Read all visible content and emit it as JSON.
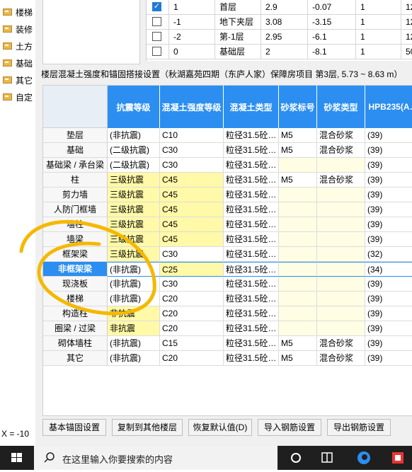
{
  "sidebar": {
    "items": [
      "楼梯",
      "装修",
      "土方",
      "基础",
      "其它",
      "自定"
    ]
  },
  "status": {
    "coordinate": "X = -10"
  },
  "floor_table": {
    "rows": [
      {
        "checked": true,
        "code": "1",
        "name": "首层",
        "height": "2.9",
        "elevation": "-0.07",
        "count": "1",
        "extra": "12"
      },
      {
        "checked": false,
        "code": "-1",
        "name": "地下夹层",
        "height": "3.08",
        "elevation": "-3.15",
        "count": "1",
        "extra": "12"
      },
      {
        "checked": false,
        "code": "-2",
        "name": "第-1层",
        "height": "2.95",
        "elevation": "-6.1",
        "count": "1",
        "extra": "12"
      },
      {
        "checked": false,
        "code": "0",
        "name": "基础层",
        "height": "2",
        "elevation": "-8.1",
        "count": "1",
        "extra": "50"
      }
    ]
  },
  "caption": "楼层混凝土强度和锚固搭接设置（秋湖嘉苑四期（东庐人家）保障房项目 第3层, 5.73 ~ 8.63 m）",
  "grid": {
    "headers": [
      "抗震等级",
      "混凝土强度等级",
      "混凝土类型",
      "砂浆标号",
      "砂浆类型",
      "HPB235(A…"
    ],
    "rows": [
      {
        "name": "垫层",
        "seismic": "(非抗震)",
        "grade": "C10",
        "type": "粒径31.5砼…",
        "mortar": "M5",
        "mtype": "混合砂浆",
        "hpb": "(39)",
        "y": [
          false,
          false,
          false,
          false,
          false
        ]
      },
      {
        "name": "基础",
        "seismic": "(二级抗震)",
        "grade": "C30",
        "type": "粒径31.5砼…",
        "mortar": "M5",
        "mtype": "混合砂浆",
        "hpb": "(39)",
        "y": [
          false,
          false,
          false,
          false,
          false
        ]
      },
      {
        "name": "基础梁 / 承台梁",
        "seismic": "(二级抗震)",
        "grade": "C30",
        "type": "粒径31.5砼…",
        "mortar": "",
        "mtype": "",
        "hpb": "(39)",
        "y": [
          false,
          false,
          false,
          true,
          true
        ]
      },
      {
        "name": "柱",
        "seismic": "三级抗震",
        "grade": "C45",
        "type": "粒径31.5砼…",
        "mortar": "M5",
        "mtype": "混合砂浆",
        "hpb": "(39)",
        "y": [
          true,
          true,
          false,
          false,
          false
        ]
      },
      {
        "name": "剪力墙",
        "seismic": "三级抗震",
        "grade": "C45",
        "type": "粒径31.5砼…",
        "mortar": "",
        "mtype": "",
        "hpb": "(39)",
        "y": [
          true,
          true,
          false,
          true,
          true
        ]
      },
      {
        "name": "人防门框墙",
        "seismic": "三级抗震",
        "grade": "C45",
        "type": "粒径31.5砼…",
        "mortar": "",
        "mtype": "",
        "hpb": "(39)",
        "y": [
          true,
          true,
          false,
          true,
          true
        ]
      },
      {
        "name": "墙柱",
        "seismic": "三级抗震",
        "grade": "C45",
        "type": "粒径31.5砼…",
        "mortar": "",
        "mtype": "",
        "hpb": "(39)",
        "y": [
          true,
          true,
          false,
          true,
          true
        ]
      },
      {
        "name": "墙梁",
        "seismic": "三级抗震",
        "grade": "C45",
        "type": "粒径31.5砼…",
        "mortar": "",
        "mtype": "",
        "hpb": "(39)",
        "y": [
          true,
          true,
          false,
          true,
          true
        ]
      },
      {
        "name": "框架梁",
        "seismic": "三级抗震",
        "grade": "C30",
        "type": "粒径31.5砼…",
        "mortar": "",
        "mtype": "",
        "hpb": "(32)",
        "y": [
          true,
          false,
          false,
          true,
          true
        ]
      },
      {
        "name": "非框架梁",
        "seismic": "(非抗震)",
        "grade": "C25",
        "type": "粒径31.5砼…",
        "mortar": "",
        "mtype": "",
        "hpb": "(34)",
        "y": [
          false,
          true,
          false,
          true,
          true
        ],
        "selected": true
      },
      {
        "name": "现浇板",
        "seismic": "(非抗震)",
        "grade": "C30",
        "type": "粒径31.5砼…",
        "mortar": "",
        "mtype": "",
        "hpb": "(39)",
        "y": [
          false,
          false,
          false,
          true,
          true
        ]
      },
      {
        "name": "楼梯",
        "seismic": "(非抗震)",
        "grade": "C20",
        "type": "粒径31.5砼…",
        "mortar": "",
        "mtype": "",
        "hpb": "(39)",
        "y": [
          false,
          false,
          false,
          true,
          true
        ]
      },
      {
        "name": "构造柱",
        "seismic": "非抗震",
        "grade": "C20",
        "type": "粒径31.5砼…",
        "mortar": "",
        "mtype": "",
        "hpb": "(39)",
        "y": [
          true,
          false,
          false,
          true,
          true
        ]
      },
      {
        "name": "圈梁 / 过梁",
        "seismic": "非抗震",
        "grade": "C20",
        "type": "粒径31.5砼…",
        "mortar": "",
        "mtype": "",
        "hpb": "(39)",
        "y": [
          true,
          false,
          false,
          true,
          true
        ]
      },
      {
        "name": "砌体墙柱",
        "seismic": "(非抗震)",
        "grade": "C15",
        "type": "粒径31.5砼…",
        "mortar": "M5",
        "mtype": "混合砂浆",
        "hpb": "(39)",
        "y": [
          false,
          false,
          false,
          false,
          false
        ]
      },
      {
        "name": "其它",
        "seismic": "(非抗震)",
        "grade": "C20",
        "type": "粒径31.5砼…",
        "mortar": "M5",
        "mtype": "混合砂浆",
        "hpb": "(39)",
        "y": [
          false,
          false,
          false,
          false,
          false
        ]
      }
    ]
  },
  "buttons": [
    "基本锚固设置",
    "复制到其他楼层",
    "恢复默认值(D)",
    "导入钢筋设置",
    "导出钢筋设置"
  ],
  "taskbar": {
    "search_placeholder": "在这里输入你要搜索的内容"
  },
  "colors": {
    "header_blue": "#2b8ef0",
    "cell_yellow": "#fff9a8",
    "annotation": "#f5b800"
  }
}
